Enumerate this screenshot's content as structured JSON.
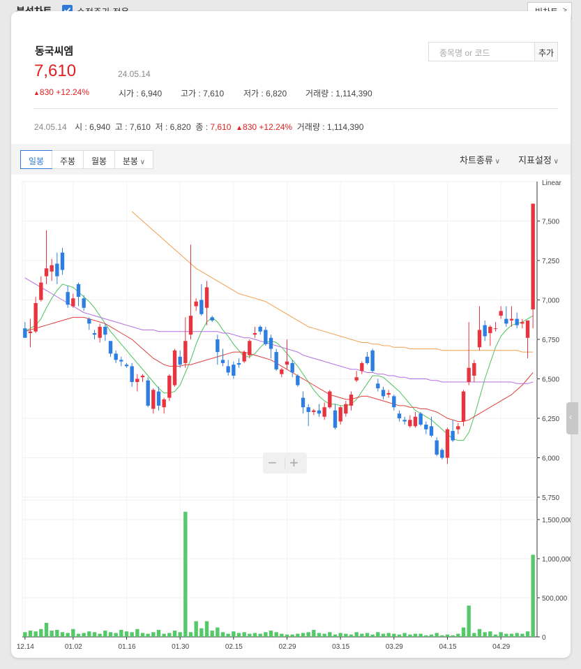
{
  "header": {
    "title": "분석차트",
    "adjusted_price_label": "수정주가 적용",
    "adjusted_price_checked": true,
    "big_chart_label": "빅차트"
  },
  "stock": {
    "name": "동국씨엠",
    "price": "7,610",
    "date": "24.05.14",
    "change": "830 +12.24%",
    "open_label": "시가",
    "open": "6,940",
    "high_label": "고가",
    "high": "7,610",
    "low_label": "저가",
    "low": "6,820",
    "volume_label": "거래량",
    "volume": "1,114,390"
  },
  "search": {
    "placeholder": "종목명 or 코드",
    "add_label": "추가"
  },
  "summary": {
    "date": "24.05.14",
    "o_label": "시",
    "o": "6,940",
    "h_label": "고",
    "h": "7,610",
    "l_label": "저",
    "l": "6,820",
    "c_label": "종",
    "c": "7,610",
    "change": "830 +12.24%",
    "v_label": "거래량",
    "v": "1,114,390"
  },
  "toolbar": {
    "tabs": [
      "일봉",
      "주봉",
      "월봉",
      "분봉"
    ],
    "active_tab": "일봉",
    "chart_type_label": "차트종류",
    "indicator_label": "지표설정"
  },
  "colors": {
    "up": "#e8343f",
    "down": "#2d7ee0",
    "volume": "#55c96a",
    "ma5": "#4cc35a",
    "ma20": "#e0403c",
    "ma60": "#b46de0",
    "ma120": "#f0a050"
  },
  "chart_data": {
    "type": "candlestick",
    "scale_label": "Linear",
    "price_ticks": [
      "7,500",
      "7,250",
      "7,000",
      "6,750",
      "6,500",
      "6,250",
      "6,000",
      "5,750"
    ],
    "volume_ticks": [
      "1,500,000",
      "1,000,000",
      "500,000",
      "0"
    ],
    "x_ticks": [
      "12.14",
      "01.02",
      "01.16",
      "01.30",
      "02.15",
      "02.29",
      "03.15",
      "03.29",
      "04.15",
      "04.29"
    ],
    "ylim": [
      5750,
      7750
    ],
    "volume_ylim": [
      0,
      1750000
    ],
    "candles": [
      [
        6820,
        6860,
        6780,
        6760
      ],
      [
        6790,
        6880,
        6700,
        6800
      ],
      [
        6800,
        7020,
        6790,
        6980
      ],
      [
        7000,
        7150,
        6990,
        7110
      ],
      [
        7150,
        7440,
        7100,
        7200
      ],
      [
        7180,
        7260,
        7120,
        7220
      ],
      [
        7230,
        7300,
        7100,
        7150
      ],
      [
        7300,
        7330,
        7160,
        7190
      ],
      [
        7050,
        7090,
        6950,
        6970
      ],
      [
        6960,
        7040,
        6950,
        7010
      ],
      [
        7100,
        7110,
        6960,
        7020
      ],
      [
        7010,
        7030,
        6930,
        6950
      ],
      [
        6880,
        6890,
        6810,
        6850
      ],
      [
        6790,
        6810,
        6750,
        6780
      ],
      [
        6760,
        6850,
        6730,
        6830
      ],
      [
        6830,
        6850,
        6740,
        6780
      ],
      [
        6740,
        6740,
        6640,
        6660
      ],
      [
        6660,
        6680,
        6600,
        6620
      ],
      [
        6620,
        6640,
        6580,
        6610
      ],
      [
        6590,
        6600,
        6570,
        6580
      ],
      [
        6580,
        6600,
        6450,
        6480
      ],
      [
        6480,
        6530,
        6420,
        6500
      ],
      [
        6510,
        6530,
        6480,
        6520
      ],
      [
        6490,
        6510,
        6320,
        6330
      ],
      [
        6310,
        6440,
        6280,
        6430
      ],
      [
        6420,
        6450,
        6300,
        6330
      ],
      [
        6320,
        6380,
        6280,
        6370
      ],
      [
        6380,
        6530,
        6360,
        6520
      ],
      [
        6460,
        6690,
        6450,
        6680
      ],
      [
        6640,
        6680,
        6570,
        6590
      ],
      [
        6600,
        6890,
        6570,
        6740
      ],
      [
        6780,
        7350,
        6750,
        6900
      ],
      [
        6960,
        7010,
        6930,
        6990
      ],
      [
        7000,
        7100,
        6900,
        6910
      ],
      [
        6950,
        7120,
        6840,
        7080
      ],
      [
        6890,
        6900,
        6860,
        6870
      ],
      [
        6750,
        6780,
        6590,
        6670
      ],
      [
        6620,
        6690,
        6580,
        6600
      ],
      [
        6580,
        6620,
        6520,
        6540
      ],
      [
        6590,
        6610,
        6500,
        6520
      ],
      [
        6600,
        6630,
        6570,
        6590
      ],
      [
        6610,
        6680,
        6600,
        6670
      ],
      [
        6650,
        6750,
        6630,
        6740
      ],
      [
        6780,
        6830,
        6760,
        6790
      ],
      [
        6830,
        6840,
        6780,
        6800
      ],
      [
        6810,
        6830,
        6710,
        6720
      ],
      [
        6760,
        6780,
        6630,
        6690
      ],
      [
        6670,
        6690,
        6550,
        6560
      ],
      [
        6530,
        6570,
        6510,
        6560
      ],
      [
        6590,
        6750,
        6560,
        6610
      ],
      [
        6600,
        6620,
        6510,
        6540
      ],
      [
        6520,
        6530,
        6450,
        6460
      ],
      [
        6380,
        6420,
        6280,
        6320
      ],
      [
        6320,
        6340,
        6200,
        6290
      ],
      [
        6290,
        6310,
        6270,
        6300
      ],
      [
        6300,
        6340,
        6260,
        6280
      ],
      [
        6260,
        6350,
        6240,
        6320
      ],
      [
        6320,
        6430,
        6310,
        6420
      ],
      [
        6300,
        6340,
        6180,
        6190
      ],
      [
        6230,
        6330,
        6210,
        6320
      ],
      [
        6280,
        6360,
        6260,
        6340
      ],
      [
        6330,
        6420,
        6300,
        6400
      ],
      [
        6490,
        6550,
        6480,
        6510
      ],
      [
        6550,
        6610,
        6530,
        6600
      ],
      [
        6640,
        6670,
        6590,
        6600
      ],
      [
        6680,
        6690,
        6540,
        6550
      ],
      [
        6470,
        6500,
        6420,
        6440
      ],
      [
        6430,
        6450,
        6370,
        6390
      ],
      [
        6400,
        6430,
        6380,
        6410
      ],
      [
        6390,
        6400,
        6300,
        6320
      ],
      [
        6280,
        6300,
        6230,
        6250
      ],
      [
        6240,
        6260,
        6210,
        6230
      ],
      [
        6200,
        6270,
        6190,
        6240
      ],
      [
        6200,
        6290,
        6190,
        6260
      ],
      [
        6280,
        6290,
        6200,
        6210
      ],
      [
        6210,
        6230,
        6150,
        6180
      ],
      [
        6200,
        6260,
        6130,
        6140
      ],
      [
        6110,
        6130,
        6010,
        6020
      ],
      [
        6050,
        6060,
        5990,
        6000
      ],
      [
        6000,
        6190,
        5960,
        6180
      ],
      [
        6170,
        6240,
        6100,
        6110
      ],
      [
        6180,
        6220,
        6150,
        6200
      ],
      [
        6230,
        6430,
        6200,
        6420
      ],
      [
        6480,
        6860,
        6460,
        6570
      ],
      [
        6520,
        6620,
        6480,
        6600
      ],
      [
        6700,
        6960,
        6680,
        6810
      ],
      [
        6840,
        6870,
        6740,
        6770
      ],
      [
        6790,
        6840,
        6710,
        6830
      ],
      [
        6820,
        6860,
        6800,
        6820
      ],
      [
        6900,
        6960,
        6880,
        6930
      ],
      [
        6880,
        6960,
        6830,
        6850
      ],
      [
        6870,
        6960,
        6830,
        6880
      ],
      [
        6880,
        6920,
        6820,
        6840
      ],
      [
        6850,
        6880,
        6820,
        6860
      ],
      [
        6760,
        6870,
        6630,
        6870
      ],
      [
        6940,
        7610,
        6820,
        7610
      ]
    ],
    "volumes": [
      60000,
      80000,
      70000,
      100000,
      180000,
      80000,
      90000,
      60000,
      50000,
      100000,
      40000,
      50000,
      70000,
      60000,
      40000,
      80000,
      60000,
      50000,
      90000,
      70000,
      60000,
      100000,
      50000,
      40000,
      60000,
      90000,
      40000,
      50000,
      80000,
      60000,
      1600000,
      60000,
      200000,
      110000,
      200000,
      80000,
      120000,
      60000,
      40000,
      70000,
      50000,
      60000,
      40000,
      50000,
      40000,
      60000,
      80000,
      60000,
      40000,
      30000,
      30000,
      40000,
      50000,
      60000,
      90000,
      50000,
      40000,
      60000,
      30000,
      50000,
      40000,
      30000,
      60000,
      40000,
      50000,
      30000,
      60000,
      40000,
      50000,
      40000,
      30000,
      50000,
      30000,
      40000,
      40000,
      20000,
      30000,
      50000,
      20000,
      30000,
      20000,
      40000,
      120000,
      400000,
      50000,
      100000,
      60000,
      70000,
      30000,
      60000,
      40000,
      40000,
      50000,
      40000,
      70000,
      1050000
    ],
    "ma_lines": [
      {
        "key": "ma5",
        "values": [
          6800,
          6820,
          6840,
          6880,
          6950,
          7010,
          7060,
          7100,
          7090,
          7080,
          7050,
          7020,
          6990,
          6950,
          6900,
          6850,
          6800,
          6760,
          6720,
          6680,
          6640,
          6600,
          6560,
          6520,
          6480,
          6440,
          6410,
          6410,
          6420,
          6460,
          6540,
          6620,
          6720,
          6800,
          6860,
          6890,
          6860,
          6810,
          6770,
          6720,
          6680,
          6640,
          6640,
          6660,
          6700,
          6730,
          6740,
          6730,
          6700,
          6660,
          6620,
          6580,
          6530,
          6480,
          6430,
          6390,
          6360,
          6340,
          6340,
          6330,
          6330,
          6340,
          6370,
          6420,
          6470,
          6520,
          6520,
          6510,
          6480,
          6450,
          6420,
          6380,
          6340,
          6300,
          6280,
          6260,
          6240,
          6210,
          6180,
          6150,
          6120,
          6110,
          6110,
          6160,
          6260,
          6380,
          6500,
          6600,
          6700,
          6770,
          6810,
          6840,
          6850,
          6860,
          6880,
          6900,
          6960
        ]
      },
      {
        "key": "ma20",
        "values": [
          6800,
          6810,
          6820,
          6830,
          6840,
          6850,
          6860,
          6870,
          6880,
          6890,
          6890,
          6890,
          6880,
          6870,
          6860,
          6850,
          6830,
          6810,
          6790,
          6770,
          6750,
          6720,
          6690,
          6660,
          6630,
          6610,
          6590,
          6580,
          6580,
          6580,
          6590,
          6590,
          6600,
          6610,
          6620,
          6630,
          6640,
          6650,
          6660,
          6670,
          6670,
          6670,
          6660,
          6650,
          6640,
          6630,
          6620,
          6600,
          6580,
          6560,
          6540,
          6520,
          6500,
          6480,
          6460,
          6440,
          6420,
          6400,
          6390,
          6380,
          6370,
          6370,
          6380,
          6390,
          6390,
          6380,
          6370,
          6360,
          6350,
          6340,
          6330,
          6330,
          6320,
          6320,
          6310,
          6310,
          6300,
          6290,
          6270,
          6250,
          6240,
          6230,
          6230,
          6240,
          6260,
          6280,
          6300,
          6320,
          6340,
          6360,
          6380,
          6400,
          6430,
          6460,
          6500,
          6540,
          6590
        ]
      },
      {
        "key": "ma60",
        "values": [
          7140,
          7120,
          7100,
          7080,
          7060,
          7040,
          7020,
          7000,
          6980,
          6960,
          6940,
          6920,
          6910,
          6900,
          6890,
          6880,
          6870,
          6860,
          6850,
          6840,
          6830,
          6820,
          6810,
          6810,
          6810,
          6800,
          6800,
          6800,
          6800,
          6800,
          6800,
          6800,
          6800,
          6800,
          6800,
          6800,
          6800,
          6790,
          6790,
          6780,
          6770,
          6760,
          6760,
          6750,
          6740,
          6730,
          6720,
          6710,
          6700,
          6690,
          6680,
          6670,
          6650,
          6640,
          6630,
          6620,
          6610,
          6600,
          6590,
          6580,
          6570,
          6560,
          6560,
          6550,
          6540,
          6540,
          6530,
          6530,
          6520,
          6520,
          6510,
          6510,
          6500,
          6500,
          6500,
          6500,
          6490,
          6490,
          6480,
          6480,
          6480,
          6480,
          6480,
          6480,
          6480,
          6480,
          6480,
          6480,
          6480,
          6480,
          6480,
          6480,
          6470,
          6470,
          6470,
          6480,
          6490
        ]
      },
      {
        "key": "ma120",
        "values": [
          null,
          null,
          null,
          null,
          null,
          null,
          null,
          null,
          null,
          null,
          null,
          null,
          null,
          null,
          null,
          null,
          null,
          null,
          null,
          null,
          7560,
          7530,
          7500,
          7470,
          7440,
          7410,
          7380,
          7350,
          7320,
          7290,
          7260,
          7230,
          7200,
          7180,
          7160,
          7140,
          7120,
          7100,
          7080,
          7060,
          7040,
          7030,
          7020,
          7010,
          7000,
          6990,
          6970,
          6950,
          6930,
          6910,
          6890,
          6870,
          6850,
          6830,
          6820,
          6810,
          6800,
          6790,
          6780,
          6770,
          6760,
          6750,
          6740,
          6730,
          6730,
          6720,
          6720,
          6710,
          6710,
          6700,
          6700,
          6700,
          6690,
          6690,
          6690,
          6690,
          6690,
          6690,
          6680,
          6680,
          6680,
          6680,
          6680,
          6680,
          6680,
          6680,
          6680,
          6680,
          6680,
          6680,
          6680,
          6680,
          6680,
          6670,
          6670,
          6670
        ]
      }
    ]
  }
}
